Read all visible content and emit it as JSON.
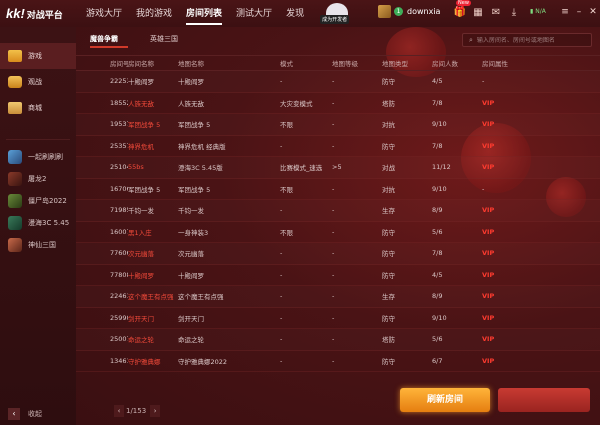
{
  "app": {
    "logo_main": "kk!",
    "logo_sub": "对战平台"
  },
  "nav": {
    "items": [
      "游戏大厅",
      "我的游戏",
      "房间列表",
      "测试大厅",
      "发现"
    ],
    "active_index": 2,
    "mascot_tag": "成为开发者"
  },
  "user": {
    "name": "downxia",
    "level": "1",
    "badge": "New",
    "net": "N/A"
  },
  "sidebar": {
    "main_items": [
      {
        "label": "游戏",
        "icon": "gamepad-icon"
      },
      {
        "label": "观战",
        "icon": "tv-icon"
      },
      {
        "label": "商城",
        "icon": "shop-icon"
      }
    ],
    "games": [
      "一起刷刷刷",
      "屠龙2",
      "僵尸岛2022",
      "漫海3C 5.45",
      "神仙三国"
    ],
    "collapse_label": "收起"
  },
  "subtabs": [
    "魔兽争霸",
    "英雄三国"
  ],
  "search": {
    "placeholder": "输入房间名、房间号或地图名"
  },
  "table": {
    "headers": [
      "房间号",
      "房间名称",
      "地图名称",
      "模式",
      "地图等级",
      "地图类型",
      "房间人数",
      "房间属性"
    ],
    "rows": [
      {
        "id": "222534",
        "room": "十殿阎罗",
        "map": "十殿阎罗",
        "mode": "-",
        "level": "-",
        "type": "防守",
        "count": "4/5",
        "attr": "-",
        "room_red": false
      },
      {
        "id": "18552",
        "room": "人族无敌",
        "map": "人族无敌",
        "mode": "大灾变模式",
        "level": "-",
        "type": "塔防",
        "count": "7/8",
        "attr": "VIP",
        "room_red": true
      },
      {
        "id": "195371",
        "room": "军团战争 5",
        "map": "军团战争 5",
        "mode": "不限",
        "level": "-",
        "type": "对抗",
        "count": "9/10",
        "attr": "VIP",
        "room_red": true
      },
      {
        "id": "253571",
        "room": "神界危机",
        "map": "神界危机 经典版",
        "mode": "-",
        "level": "-",
        "type": "防守",
        "count": "7/8",
        "attr": "VIP",
        "room_red": true
      },
      {
        "id": "251044",
        "room": "55bs",
        "map": "澄海3C 5.45版",
        "mode": "比赛模式_速选",
        "level": ">5",
        "type": "对战",
        "count": "11/12",
        "attr": "VIP",
        "room_red": true
      },
      {
        "id": "167061",
        "room": "军团战争 5",
        "map": "军团战争 5",
        "mode": "不限",
        "level": "-",
        "type": "对抗",
        "count": "9/10",
        "attr": "-",
        "room_red": false
      },
      {
        "id": "71985",
        "room": "千钧一发",
        "map": "千钧一发",
        "mode": "-",
        "level": "-",
        "type": "生存",
        "count": "8/9",
        "attr": "VIP",
        "room_red": false
      },
      {
        "id": "160071",
        "room": "黑1入庄",
        "map": "一身神装3",
        "mode": "不限",
        "level": "-",
        "type": "防守",
        "count": "5/6",
        "attr": "VIP",
        "room_red": true
      },
      {
        "id": "77606",
        "room": "次元幽落",
        "map": "次元幽落",
        "mode": "-",
        "level": "-",
        "type": "防守",
        "count": "7/8",
        "attr": "VIP",
        "room_red": true
      },
      {
        "id": "77808",
        "room": "十殿阎罗",
        "map": "十殿阎罗",
        "mode": "-",
        "level": "-",
        "type": "防守",
        "count": "4/5",
        "attr": "VIP",
        "room_red": true
      },
      {
        "id": "224615",
        "room": "这个魔王有点强",
        "map": "这个魔王有点强",
        "mode": "-",
        "level": "-",
        "type": "生存",
        "count": "8/9",
        "attr": "VIP",
        "room_red": true
      },
      {
        "id": "259902",
        "room": "剑开天门",
        "map": "剑开天门",
        "mode": "-",
        "level": "-",
        "type": "防守",
        "count": "9/10",
        "attr": "VIP",
        "room_red": true
      },
      {
        "id": "250079",
        "room": "命运之轮",
        "map": "命运之轮",
        "mode": "-",
        "level": "-",
        "type": "塔防",
        "count": "5/6",
        "attr": "VIP",
        "room_red": true
      },
      {
        "id": "134610",
        "room": "守护雅典娜",
        "map": "守护雅典娜2022",
        "mode": "-",
        "level": "-",
        "type": "防守",
        "count": "6/7",
        "attr": "VIP",
        "room_red": true
      }
    ]
  },
  "pager": {
    "label": "1/153"
  },
  "buttons": {
    "refresh": "刷新房间"
  },
  "colors": {
    "accent_red": "#f24a3a",
    "vip": "#ff3b2f",
    "refresh_btn": "#f59a22",
    "background": "#3a1012"
  }
}
